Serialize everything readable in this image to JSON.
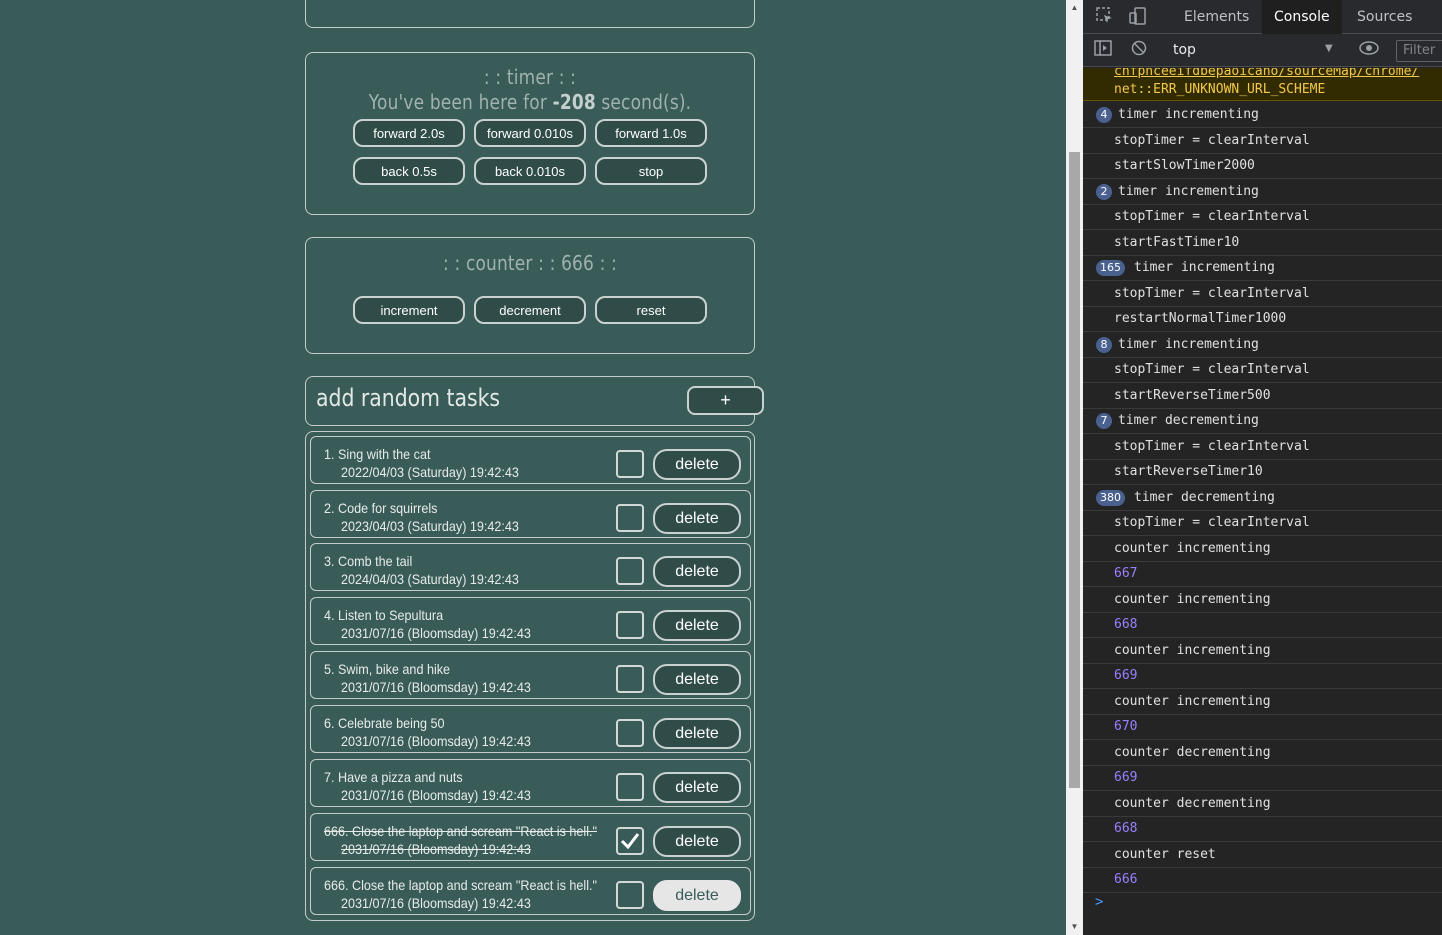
{
  "timer": {
    "title": ": : timer : :",
    "message_prefix": "You've been here for",
    "value": "-208",
    "message_suffix": "second(s).",
    "buttons": [
      "forward 2.0s",
      "forward 0.010s",
      "forward 1.0s",
      "back 0.5s",
      "back 0.010s",
      "stop"
    ]
  },
  "counter": {
    "title": ": : counter : : 666 : :",
    "buttons": [
      "increment",
      "decrement",
      "reset"
    ]
  },
  "add_tasks": {
    "label": "add random tasks",
    "button": "+"
  },
  "tasks": [
    {
      "title": "1. Sing with the cat",
      "date": "2022/04/03 (Saturday) 19:42:43",
      "checked": false,
      "delete": "delete"
    },
    {
      "title": "2. Code for squirrels",
      "date": "2023/04/03 (Saturday) 19:42:43",
      "checked": false,
      "delete": "delete"
    },
    {
      "title": "3. Comb the tail",
      "date": "2024/04/03 (Saturday) 19:42:43",
      "checked": false,
      "delete": "delete"
    },
    {
      "title": "4. Listen to Sepultura",
      "date": "2031/07/16 (Bloomsday) 19:42:43",
      "checked": false,
      "delete": "delete"
    },
    {
      "title": "5. Swim, bike and hike",
      "date": "2031/07/16 (Bloomsday) 19:42:43",
      "checked": false,
      "delete": "delete"
    },
    {
      "title": "6. Celebrate being 50",
      "date": "2031/07/16 (Bloomsday) 19:42:43",
      "checked": false,
      "delete": "delete"
    },
    {
      "title": "7. Have a pizza and nuts",
      "date": "2031/07/16 (Bloomsday) 19:42:43",
      "checked": false,
      "delete": "delete"
    },
    {
      "title": "666. Close the laptop and scream \"React is hell.\"",
      "date": "2031/07/16 (Bloomsday) 19:42:43",
      "checked": true,
      "delete": "delete"
    },
    {
      "title": "666. Close the laptop and scream \"React is hell.\"",
      "date": "2031/07/16 (Bloomsday) 19:42:43",
      "checked": false,
      "delete": "delete"
    }
  ],
  "devtools": {
    "tabs": [
      "Elements",
      "Console",
      "Sources"
    ],
    "active_tab": "Console",
    "context": "top",
    "filter_placeholder": "Filter",
    "warning": {
      "line1": "chfphceeifdbepaoicaho/sourceMap/chrome/",
      "line2": "net::ERR_UNKNOWN_URL_SCHEME"
    },
    "console_lines": [
      {
        "badge": "4",
        "text": "timer incrementing",
        "kind": "log"
      },
      {
        "badge": "",
        "text": "stopTimer = clearInterval",
        "kind": "log"
      },
      {
        "badge": "",
        "text": "startSlowTimer2000",
        "kind": "log"
      },
      {
        "badge": "2",
        "text": "timer incrementing",
        "kind": "log"
      },
      {
        "badge": "",
        "text": "stopTimer = clearInterval",
        "kind": "log"
      },
      {
        "badge": "",
        "text": "startFastTimer10",
        "kind": "log"
      },
      {
        "badge": "165",
        "text": "timer incrementing",
        "kind": "log"
      },
      {
        "badge": "",
        "text": "stopTimer = clearInterval",
        "kind": "log"
      },
      {
        "badge": "",
        "text": "restartNormalTimer1000",
        "kind": "log"
      },
      {
        "badge": "8",
        "text": "timer incrementing",
        "kind": "log"
      },
      {
        "badge": "",
        "text": "stopTimer = clearInterval",
        "kind": "log"
      },
      {
        "badge": "",
        "text": "startReverseTimer500",
        "kind": "log"
      },
      {
        "badge": "7",
        "text": "timer decrementing",
        "kind": "log"
      },
      {
        "badge": "",
        "text": "stopTimer = clearInterval",
        "kind": "log"
      },
      {
        "badge": "",
        "text": "startReverseTimer10",
        "kind": "log"
      },
      {
        "badge": "380",
        "text": "timer decrementing",
        "kind": "log"
      },
      {
        "badge": "",
        "text": "stopTimer = clearInterval",
        "kind": "log"
      },
      {
        "badge": "",
        "text": "counter incrementing",
        "kind": "log"
      },
      {
        "badge": "",
        "text": "667",
        "kind": "num"
      },
      {
        "badge": "",
        "text": "counter incrementing",
        "kind": "log"
      },
      {
        "badge": "",
        "text": "668",
        "kind": "num"
      },
      {
        "badge": "",
        "text": "counter incrementing",
        "kind": "log"
      },
      {
        "badge": "",
        "text": "669",
        "kind": "num"
      },
      {
        "badge": "",
        "text": "counter incrementing",
        "kind": "log"
      },
      {
        "badge": "",
        "text": "670",
        "kind": "num"
      },
      {
        "badge": "",
        "text": "counter decrementing",
        "kind": "log"
      },
      {
        "badge": "",
        "text": "669",
        "kind": "num"
      },
      {
        "badge": "",
        "text": "counter decrementing",
        "kind": "log"
      },
      {
        "badge": "",
        "text": "668",
        "kind": "num"
      },
      {
        "badge": "",
        "text": "counter reset",
        "kind": "log"
      },
      {
        "badge": "",
        "text": "666",
        "kind": "num"
      }
    ],
    "prompt": ">"
  }
}
